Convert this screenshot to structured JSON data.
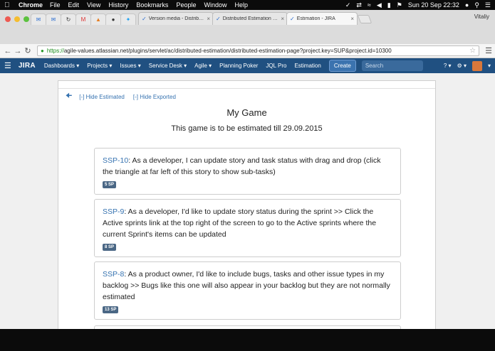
{
  "menubar": {
    "app": "Chrome",
    "items": [
      "File",
      "Edit",
      "View",
      "History",
      "Bookmarks",
      "People",
      "Window",
      "Help"
    ],
    "datetime": "Sun 20 Sep  22:32"
  },
  "browser": {
    "tabs": [
      {
        "label": "Version media - Distributed E"
      },
      {
        "label": "Distributed Estimation | Atlas"
      },
      {
        "label": "Estimation - JIRA"
      }
    ],
    "profile": "Vitaliy",
    "url_scheme": "https://",
    "url_rest": "agile-values.atlassian.net/plugins/servlet/ac/distributed-estimation/distributed-estimation-page?project.key=SUP&project.id=10300"
  },
  "jira": {
    "logo": "JIRA",
    "nav": [
      "Dashboards ▾",
      "Projects ▾",
      "Issues ▾",
      "Service Desk ▾",
      "Agile ▾",
      "Planning Poker",
      "JQL Pro",
      "Estimation"
    ],
    "create": "Create",
    "search_placeholder": "Search"
  },
  "page": {
    "hide_estimated": "[-] Hide Estimated",
    "hide_exported": "[-] Hide Exported",
    "title": "My Game",
    "subtitle": "This game is to be estimated till 29.09.2015",
    "stories": [
      {
        "key": "SSP-10",
        "text": ": As a developer, I can update story and task status with drag and drop (click the triangle at far left of this story to show sub-tasks)",
        "sp": "5 SP"
      },
      {
        "key": "SSP-9",
        "text": ": As a developer, I'd like to update story status during the sprint >> Click the Active sprints link at the top right of the screen to go to the Active sprints where the current Sprint's items can be updated",
        "sp": "8 SP"
      },
      {
        "key": "SSP-8",
        "text": ": As a product owner, I'd like to include bugs, tasks and other issue types in my backlog >> Bugs like this one will also appear in your backlog but they are not normally estimated",
        "sp": "13 SP"
      }
    ]
  },
  "colors": {
    "jira_header": "#205081",
    "link": "#3572b0",
    "sp_badge": "#4a6785"
  }
}
